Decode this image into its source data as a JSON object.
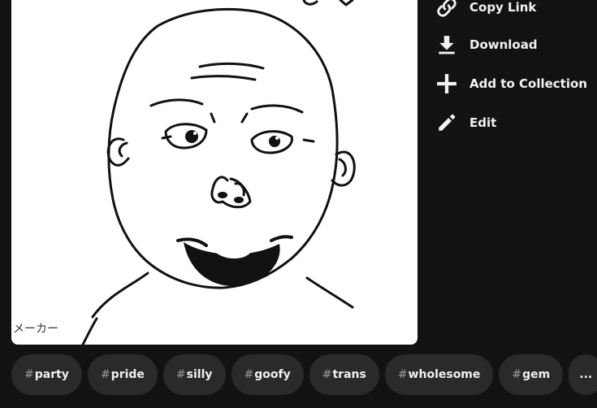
{
  "image": {
    "alt": "",
    "caption": "メーカー"
  },
  "actions": [
    {
      "label": "Copy Link",
      "icon": "link-icon"
    },
    {
      "label": "Download",
      "icon": "download-icon"
    },
    {
      "label": "Add to Collection",
      "icon": "plus-icon"
    },
    {
      "label": "Edit",
      "icon": "pencil-icon"
    }
  ],
  "tags": [
    {
      "hash": "#",
      "text": "party"
    },
    {
      "hash": "#",
      "text": "pride"
    },
    {
      "hash": "#",
      "text": "silly"
    },
    {
      "hash": "#",
      "text": "goofy"
    },
    {
      "hash": "#",
      "text": "trans"
    },
    {
      "hash": "#",
      "text": "wholesome"
    },
    {
      "hash": "#",
      "text": "gem"
    }
  ],
  "more_tags_label": "...",
  "colors": {
    "background": "#121212",
    "tag_background": "#2a2a2a",
    "text": "#ffffff"
  }
}
